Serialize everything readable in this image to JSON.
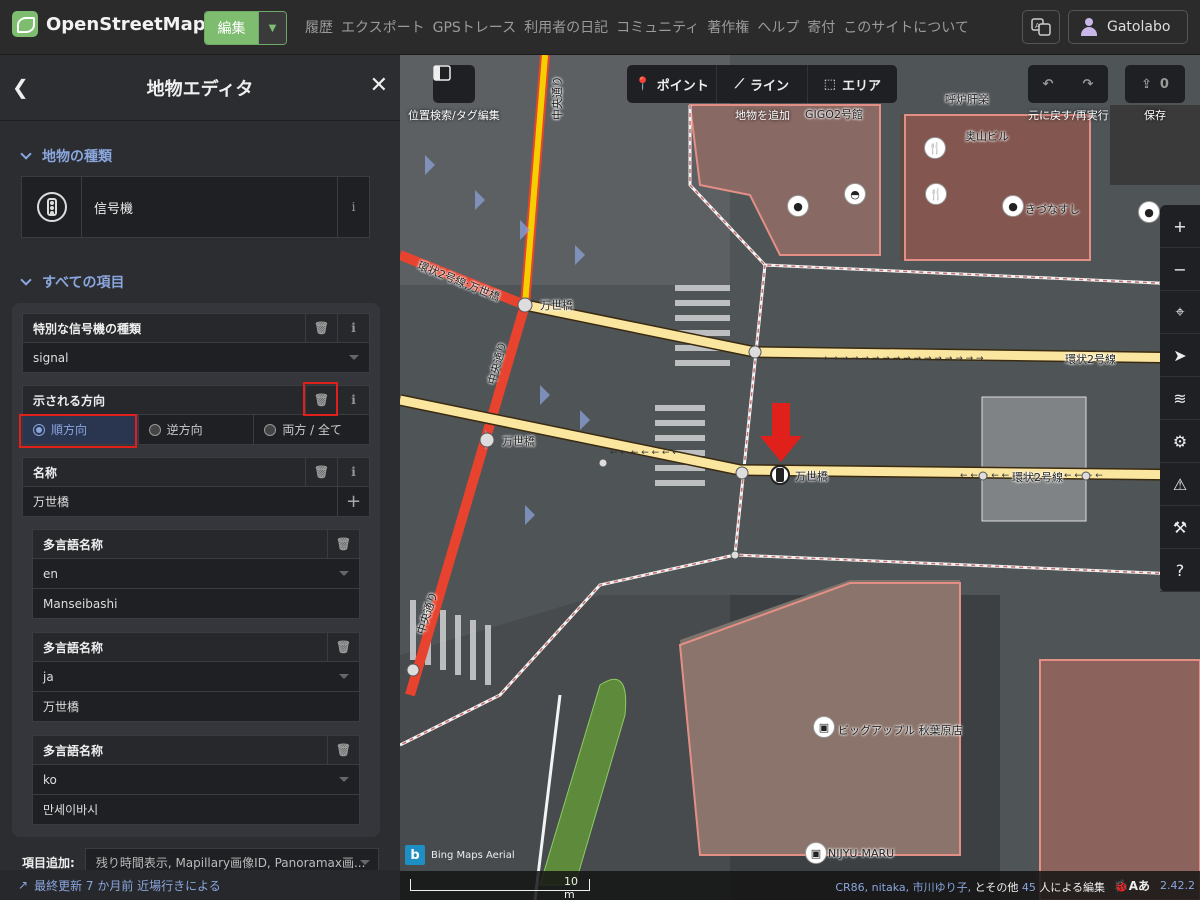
{
  "app": {
    "logo_text": "OpenStreetMap",
    "edit_label": "編集",
    "nav": [
      "履歴",
      "エクスポート",
      "GPSトレース",
      "利用者の日記",
      "コミュニティ",
      "著作権",
      "ヘルプ",
      "寄付",
      "このサイトについて"
    ],
    "user_name": "Gatolabo"
  },
  "sidebar": {
    "title": "地物エディタ",
    "feature_type_heading": "地物の種類",
    "preset_name": "信号機",
    "all_fields_heading": "すべての項目",
    "fields": {
      "signal_type": {
        "label": "特別な信号機の種類",
        "value": "signal"
      },
      "direction": {
        "label": "示される方向",
        "options": [
          "順方向",
          "逆方向",
          "両方 / 全て"
        ],
        "selected": "順方向"
      },
      "name": {
        "label": "名称",
        "value": "万世橋"
      }
    },
    "multilingual": [
      {
        "label": "多言語名称",
        "lang": "en",
        "value": "Manseibashi"
      },
      {
        "label": "多言語名称",
        "lang": "ja",
        "value": "万世橋"
      },
      {
        "label": "多言語名称",
        "lang": "ko",
        "value": "만세이바시"
      }
    ],
    "add_field_label": "項目追加:",
    "add_field_placeholder": "残り時間表示, Mapillary画像ID, Panoramax画...",
    "last_edit": "最終更新 7 か月前 近場行きによる"
  },
  "map": {
    "toolbar": {
      "search_caption": "位置検索/タグ編集",
      "point_label": "ポイント",
      "line_label": "ライン",
      "area_label": "エリア",
      "add_caption": "地物を追加",
      "undo_caption": "元に戻す/再実行",
      "save_caption": "保存",
      "save_count": "0"
    },
    "labels": {
      "road_chuo_1": "中央通り",
      "road_chuo_2": "中央通り",
      "road_chuo_3": "中央通り",
      "road_kanjo": "環状2号線;万世橋",
      "road_kanjo_right1": "環状2号線",
      "road_kanjo_right2": "環状2号線",
      "bridge1": "万世橋",
      "bridge2": "万世橋",
      "bridge3": "万世橋",
      "building_okuyama": "奥山ビル",
      "shop_1": "GIGO2号館",
      "shop_2": "呼炉肝楽",
      "shop_3": "きづなすし",
      "shop_4": "ビッグアップル 秋葉原店",
      "shop_5": "NIJYU-MARU"
    },
    "imagery": "Bing Maps Aerial",
    "scale_label": "10 m",
    "contributors_prefix": "CR86, nitaka, 市川ゆり子,",
    "contributors_suffix": "とその他",
    "contributors_count": "45",
    "contributors_tail": "人による編集",
    "version": "2.42.2"
  },
  "colors": {
    "accent": "#7ebc6f",
    "highlight": "#e0201a",
    "link": "#8aa6dd",
    "road_primary": "#e8432e",
    "road_trunk": "#fbe6a0"
  }
}
